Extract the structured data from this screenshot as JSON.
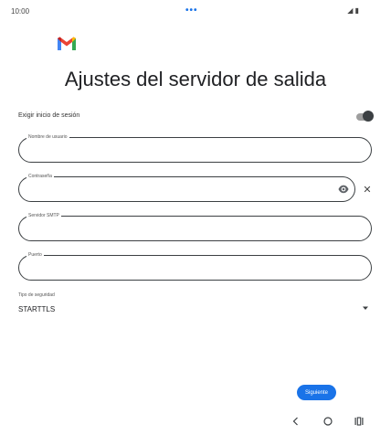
{
  "status_bar": {
    "time": "10:00",
    "center_dots": "•••",
    "icons": "◢ ▮"
  },
  "app": {
    "logo_icon": "gmail-logo-icon"
  },
  "page": {
    "title": "Ajustes del servidor de salida"
  },
  "login_toggle": {
    "label": "Exigir inicio de sesión",
    "on": true
  },
  "fields": {
    "username": {
      "label": "Nombre de usuario",
      "value": ""
    },
    "password": {
      "label": "Contraseña",
      "value": ""
    },
    "smtp": {
      "label": "Servidor SMTP",
      "value": ""
    },
    "port": {
      "label": "Puerto",
      "value": ""
    }
  },
  "security": {
    "label": "Tipo de seguridad",
    "selected": "STARTTLS"
  },
  "actions": {
    "next_label": "Siguiente"
  },
  "colors": {
    "accent": "#1a73e8",
    "gmail_red": "#ea4335",
    "toggle_thumb": "#3c4043"
  },
  "nav": {
    "back_icon": "back-icon",
    "home_icon": "home-icon",
    "recent_icon": "recent-apps-icon"
  }
}
